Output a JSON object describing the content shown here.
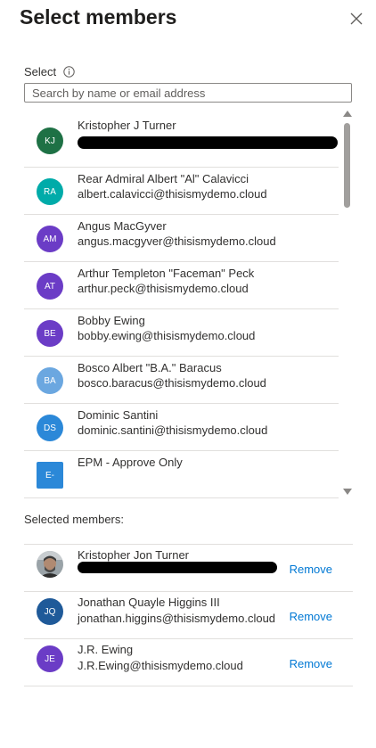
{
  "panel": {
    "title": "Select members",
    "close_icon": "close-icon"
  },
  "select": {
    "label": "Select",
    "info_icon": "info-icon",
    "search_placeholder": "Search by name or email address",
    "search_value": ""
  },
  "directory": {
    "items": [
      {
        "initials": "KJ",
        "name": "Kristopher J Turner",
        "email": "",
        "color": "#1e7145",
        "email_redacted": true
      },
      {
        "initials": "RA",
        "name": "Rear Admiral Albert \"Al\" Calavicci",
        "email": "albert.calavicci@thisismydemo.cloud",
        "color": "#00aba9"
      },
      {
        "initials": "AM",
        "name": "Angus MacGyver",
        "email": "angus.macgyver@thisismydemo.cloud",
        "color": "#6b3cc6"
      },
      {
        "initials": "AT",
        "name": "Arthur Templeton \"Faceman\" Peck",
        "email": "arthur.peck@thisismydemo.cloud",
        "color": "#6b3cc6"
      },
      {
        "initials": "BE",
        "name": "Bobby Ewing",
        "email": "bobby.ewing@thisismydemo.cloud",
        "color": "#6b3cc6"
      },
      {
        "initials": "BA",
        "name": "Bosco Albert \"B.A.\" Baracus",
        "email": "bosco.baracus@thisismydemo.cloud",
        "color": "#6ba7e0"
      },
      {
        "initials": "DS",
        "name": "Dominic Santini",
        "email": "dominic.santini@thisismydemo.cloud",
        "color": "#2b88d8"
      },
      {
        "initials": "E-",
        "name": "EPM - Approve Only",
        "email": "",
        "color": "#2b88d8",
        "square": true
      }
    ]
  },
  "selected": {
    "title": "Selected members:",
    "remove_label": "Remove",
    "items": [
      {
        "initials": "",
        "name": "Kristopher Jon Turner",
        "email": "",
        "photo": true,
        "email_redacted": true
      },
      {
        "initials": "JQ",
        "name": "Jonathan Quayle Higgins III",
        "email": "jonathan.higgins@thisismydemo.cloud",
        "color": "#1f5a99"
      },
      {
        "initials": "JE",
        "name": "J.R. Ewing",
        "email": "J.R.Ewing@thisismydemo.cloud",
        "color": "#6b3cc6"
      }
    ]
  }
}
